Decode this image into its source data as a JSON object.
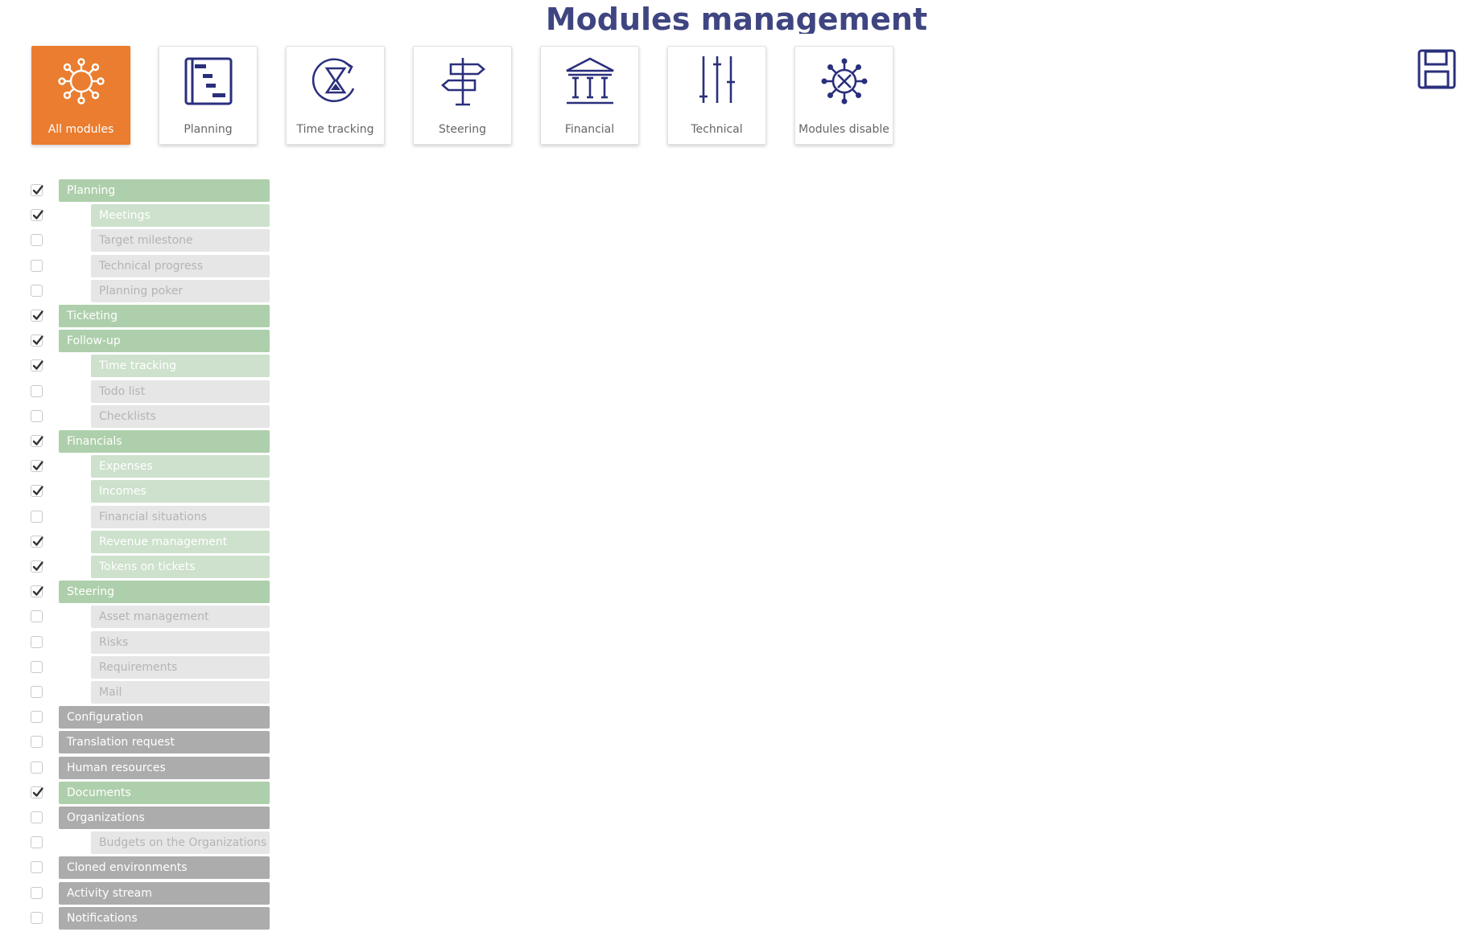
{
  "page": {
    "title": "Modules management"
  },
  "colors": {
    "accent": "#ea7d30",
    "icon": "#2a2f7c",
    "enabled_parent": "#aecfab",
    "enabled_child": "#cde1cc",
    "disabled_parent": "#acacac",
    "disabled_child": "#e6e6e6"
  },
  "tiles": [
    {
      "label": "All modules",
      "icon": "sun-network-icon",
      "active": true
    },
    {
      "label": "Planning",
      "icon": "gantt-icon",
      "active": false
    },
    {
      "label": "Time tracking",
      "icon": "hourglass-refresh-icon",
      "active": false
    },
    {
      "label": "Steering",
      "icon": "signpost-icon",
      "active": false
    },
    {
      "label": "Financial",
      "icon": "bank-icon",
      "active": false
    },
    {
      "label": "Technical",
      "icon": "sliders-icon",
      "active": false
    },
    {
      "label": "Modules disable",
      "icon": "disable-network-icon",
      "active": false
    }
  ],
  "toolbar": {
    "save_icon": "floppy-disk-icon"
  },
  "modules": [
    {
      "label": "Planning",
      "level": 0,
      "checked": true
    },
    {
      "label": "Meetings",
      "level": 1,
      "checked": true
    },
    {
      "label": "Target milestone",
      "level": 1,
      "checked": false
    },
    {
      "label": "Technical progress",
      "level": 1,
      "checked": false
    },
    {
      "label": "Planning poker",
      "level": 1,
      "checked": false
    },
    {
      "label": "Ticketing",
      "level": 0,
      "checked": true
    },
    {
      "label": "Follow-up",
      "level": 0,
      "checked": true
    },
    {
      "label": "Time tracking",
      "level": 1,
      "checked": true
    },
    {
      "label": "Todo list",
      "level": 1,
      "checked": false
    },
    {
      "label": "Checklists",
      "level": 1,
      "checked": false
    },
    {
      "label": "Financials",
      "level": 0,
      "checked": true
    },
    {
      "label": "Expenses",
      "level": 1,
      "checked": true
    },
    {
      "label": "Incomes",
      "level": 1,
      "checked": true
    },
    {
      "label": "Financial situations",
      "level": 1,
      "checked": false
    },
    {
      "label": "Revenue management",
      "level": 1,
      "checked": true
    },
    {
      "label": "Tokens on tickets",
      "level": 1,
      "checked": true
    },
    {
      "label": "Steering",
      "level": 0,
      "checked": true
    },
    {
      "label": "Asset management",
      "level": 1,
      "checked": false
    },
    {
      "label": "Risks",
      "level": 1,
      "checked": false
    },
    {
      "label": "Requirements",
      "level": 1,
      "checked": false
    },
    {
      "label": "Mail",
      "level": 1,
      "checked": false
    },
    {
      "label": "Configuration",
      "level": 0,
      "checked": false
    },
    {
      "label": "Translation request",
      "level": 0,
      "checked": false
    },
    {
      "label": "Human resources",
      "level": 0,
      "checked": false
    },
    {
      "label": "Documents",
      "level": 0,
      "checked": true
    },
    {
      "label": "Organizations",
      "level": 0,
      "checked": false
    },
    {
      "label": "Budgets on the Organizations",
      "level": 1,
      "checked": false
    },
    {
      "label": "Cloned environments",
      "level": 0,
      "checked": false
    },
    {
      "label": "Activity stream",
      "level": 0,
      "checked": false
    },
    {
      "label": "Notifications",
      "level": 0,
      "checked": false
    }
  ]
}
